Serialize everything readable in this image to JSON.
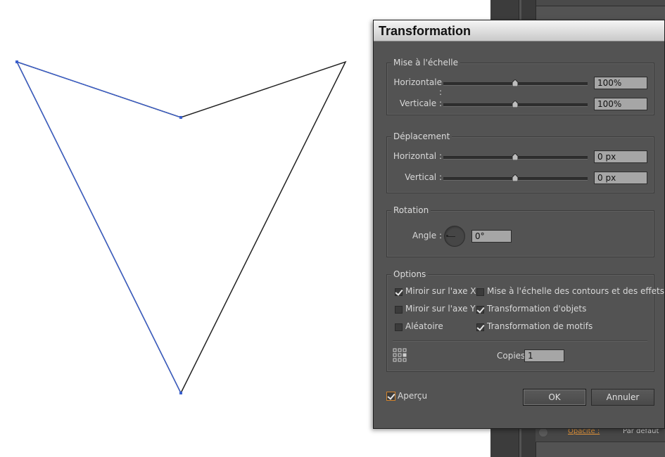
{
  "background_panel": {
    "opacity_label": "Opacité :",
    "opacity_value": "Par défaut"
  },
  "dialog": {
    "title": "Transformation",
    "scale": {
      "group_title": "Mise à l'échelle",
      "horizontal_label": "Horizontale :",
      "horizontal_value": "100%",
      "vertical_label": "Verticale :",
      "vertical_value": "100%"
    },
    "move": {
      "group_title": "Déplacement",
      "horizontal_label": "Horizontal :",
      "horizontal_value": "0 px",
      "vertical_label": "Vertical :",
      "vertical_value": "0 px"
    },
    "rotation": {
      "group_title": "Rotation",
      "angle_label": "Angle :",
      "angle_value": "0°"
    },
    "options": {
      "group_title": "Options",
      "mirror_x": "Miroir sur l'axe X",
      "mirror_y": "Miroir sur l'axe Y",
      "random": "Aléatoire",
      "scale_strokes": "Mise à l'échelle des contours et des effets",
      "transform_objects": "Transformation d'objets",
      "transform_patterns": "Transformation de motifs",
      "copies_label": "Copies",
      "copies_value": "1"
    },
    "preview_label": "Aperçu",
    "ok_label": "OK",
    "cancel_label": "Annuler"
  },
  "colors": {
    "selection_path": "#3a5fcd",
    "dialog_bg": "#535353",
    "accent_checkbox": "#d4832a"
  }
}
